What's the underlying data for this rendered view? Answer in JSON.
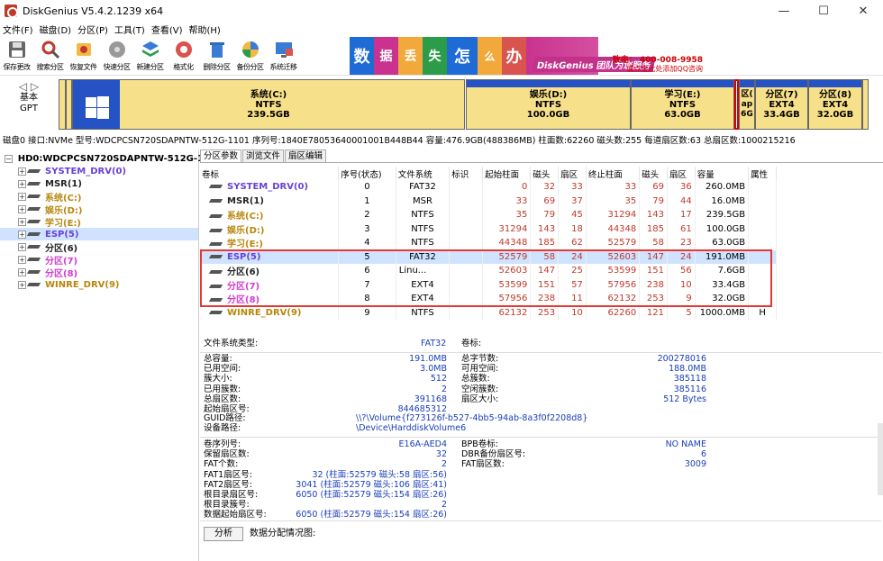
{
  "window": {
    "title": "DiskGenius V5.4.2.1239 x64",
    "buttons": [
      "—",
      "☐",
      "✕"
    ]
  },
  "menu": [
    "文件(F)",
    "磁盘(D)",
    "分区(P)",
    "工具(T)",
    "查看(V)",
    "帮助(H)"
  ],
  "toolbar": [
    "保存更改",
    "搜索分区",
    "恢复文件",
    "快速分区",
    "新建分区",
    "格式化",
    "删除分区",
    "备份分区",
    "系统迁移"
  ],
  "banner": {
    "tiles": [
      "数",
      "据",
      "丢",
      "失",
      "怎",
      "么",
      "办"
    ],
    "slogan": "DiskGenius 团队为您服务",
    "phone": "致电： 400-008-9958",
    "qq": "或点击此处添加QQ咨询"
  },
  "disk_nav": {
    "line1": "基本",
    "line2": "GPT"
  },
  "disk_map": [
    {
      "name": "系统(C:)",
      "fs": "NTFS",
      "size": "239.5GB",
      "color": "#fff"
    },
    {
      "name": "娱乐(D:)",
      "fs": "NTFS",
      "size": "100.0GB",
      "color": "#fff"
    },
    {
      "name": "学习(E:)",
      "fs": "NTFS",
      "size": "63.0GB",
      "color": "#fff"
    },
    {
      "name": "区(",
      "fs": "ap",
      "size": "6G",
      "color": "#fff"
    },
    {
      "name": "分区(7)",
      "fs": "EXT4",
      "size": "33.4GB",
      "color": "#fff"
    },
    {
      "name": "分区(8)",
      "fs": "EXT4",
      "size": "32.0GB",
      "color": "#fff"
    }
  ],
  "disk_info": "磁盘0 接口:NVMe  型号:WDCPCSN720SDAPNTW-512G-1101  序列号:1840E78053640001001B448B44  容量:476.9GB(488386MB)  柱面数:62260  磁头数:255  每道扇区数:63  总扇区数:1000215216",
  "tree": {
    "disk": "HD0:WDCPCSN720SDAPNTW-512G-1",
    "items": [
      {
        "label": "SYSTEM_DRV(0)",
        "color": "#6a3fd8"
      },
      {
        "label": "MSR(1)",
        "color": "#222"
      },
      {
        "label": "系统(C:)",
        "color": "#b8860b"
      },
      {
        "label": "娱乐(D:)",
        "color": "#b8860b"
      },
      {
        "label": "学习(E:)",
        "color": "#b8860b"
      },
      {
        "label": "ESP(5)",
        "color": "#6a3fd8"
      },
      {
        "label": "分区(6)",
        "color": "#222"
      },
      {
        "label": "分区(7)",
        "color": "#d13bd1"
      },
      {
        "label": "分区(8)",
        "color": "#d13bd1"
      },
      {
        "label": "WINRE_DRV(9)",
        "color": "#b8860b"
      }
    ]
  },
  "tabs": [
    "分区参数",
    "浏览文件",
    "扇区编辑"
  ],
  "table": {
    "headers": [
      "卷标",
      "序号(状态)",
      "文件系统",
      "标识",
      "起始柱面",
      "磁头",
      "扇区",
      "终止柱面",
      "磁头",
      "扇区",
      "容量",
      "属性"
    ],
    "rows": [
      {
        "label": "SYSTEM_DRV(0)",
        "idx": "0",
        "fs": "FAT32",
        "id": "",
        "sc": "0",
        "sh": "32",
        "ss": "33",
        "ec": "33",
        "eh": "69",
        "es": "36",
        "cap": "260.0MB",
        "attr": "",
        "color": "#6a3fd8"
      },
      {
        "label": "MSR(1)",
        "idx": "1",
        "fs": "MSR",
        "id": "",
        "sc": "33",
        "sh": "69",
        "ss": "37",
        "ec": "35",
        "eh": "79",
        "es": "44",
        "cap": "16.0MB",
        "attr": "",
        "color": "#222"
      },
      {
        "label": "系统(C:)",
        "idx": "2",
        "fs": "NTFS",
        "id": "",
        "sc": "35",
        "sh": "79",
        "ss": "45",
        "ec": "31294",
        "eh": "143",
        "es": "17",
        "cap": "239.5GB",
        "attr": "",
        "color": "#b8860b"
      },
      {
        "label": "娱乐(D:)",
        "idx": "3",
        "fs": "NTFS",
        "id": "",
        "sc": "31294",
        "sh": "143",
        "ss": "18",
        "ec": "44348",
        "eh": "185",
        "es": "61",
        "cap": "100.0GB",
        "attr": "",
        "color": "#b8860b"
      },
      {
        "label": "学习(E:)",
        "idx": "4",
        "fs": "NTFS",
        "id": "",
        "sc": "44348",
        "sh": "185",
        "ss": "62",
        "ec": "52579",
        "eh": "58",
        "es": "23",
        "cap": "63.0GB",
        "attr": "",
        "color": "#b8860b"
      },
      {
        "label": "ESP(5)",
        "idx": "5",
        "fs": "FAT32",
        "id": "",
        "sc": "52579",
        "sh": "58",
        "ss": "24",
        "ec": "52603",
        "eh": "147",
        "es": "24",
        "cap": "191.0MB",
        "attr": "",
        "color": "#6a3fd8"
      },
      {
        "label": "分区(6)",
        "idx": "6",
        "fs": "Linu...",
        "id": "",
        "sc": "52603",
        "sh": "147",
        "ss": "25",
        "ec": "53599",
        "eh": "151",
        "es": "56",
        "cap": "7.6GB",
        "attr": "",
        "color": "#222"
      },
      {
        "label": "分区(7)",
        "idx": "7",
        "fs": "EXT4",
        "id": "",
        "sc": "53599",
        "sh": "151",
        "ss": "57",
        "ec": "57956",
        "eh": "238",
        "es": "10",
        "cap": "33.4GB",
        "attr": "",
        "color": "#d13bd1"
      },
      {
        "label": "分区(8)",
        "idx": "8",
        "fs": "EXT4",
        "id": "",
        "sc": "57956",
        "sh": "238",
        "ss": "11",
        "ec": "62132",
        "eh": "253",
        "es": "9",
        "cap": "32.0GB",
        "attr": "",
        "color": "#d13bd1"
      },
      {
        "label": "WINRE_DRV(9)",
        "idx": "9",
        "fs": "NTFS",
        "id": "",
        "sc": "62132",
        "sh": "253",
        "ss": "10",
        "ec": "62260",
        "eh": "121",
        "es": "5",
        "cap": "1000.0MB",
        "attr": "H",
        "color": "#b8860b"
      }
    ]
  },
  "details": {
    "fs_type_label": "文件系统类型:",
    "fs_type": "FAT32",
    "volume_label": "卷标:",
    "left": [
      [
        "总容量:",
        "191.0MB"
      ],
      [
        "已用空间:",
        "3.0MB"
      ],
      [
        "簇大小:",
        "512"
      ],
      [
        "已用簇数:",
        "2"
      ],
      [
        "总扇区数:",
        "391168"
      ],
      [
        "起始扇区号:",
        "844685312"
      ]
    ],
    "right": [
      [
        "总字节数:",
        "200278016"
      ],
      [
        "可用空间:",
        "188.0MB"
      ],
      [
        "总簇数:",
        "385118"
      ],
      [
        "空闲簇数:",
        "385116"
      ],
      [
        "扇区大小:",
        "512 Bytes"
      ]
    ],
    "guid_label": "GUID路径:",
    "guid": "\\\\?\\Volume{f273126f-b527-4bb5-94ab-8a3f0f2208d8}",
    "dev_label": "设备路径:",
    "dev": "\\Device\\HarddiskVolume6",
    "left2": [
      [
        "卷序列号:",
        "E16A-AED4"
      ],
      [
        "保留扇区数:",
        "32"
      ],
      [
        "FAT个数:",
        "2"
      ],
      [
        "FAT1扇区号:",
        "32 (柱面:52579 磁头:58 扇区:56)"
      ],
      [
        "FAT2扇区号:",
        "3041 (柱面:52579 磁头:106 扇区:41)"
      ],
      [
        "根目录扇区号:",
        "6050 (柱面:52579 磁头:154 扇区:26)"
      ],
      [
        "根目录簇号:",
        "2"
      ],
      [
        "数据起始扇区号:",
        "6050 (柱面:52579 磁头:154 扇区:26)"
      ]
    ],
    "right2": [
      [
        "BPB卷标:",
        "NO NAME"
      ],
      [
        "DBR备份扇区号:",
        "6"
      ],
      [
        "FAT扇区数:",
        "3009"
      ]
    ],
    "analyze": "分析",
    "alloc_label": "数据分配情况图:"
  }
}
